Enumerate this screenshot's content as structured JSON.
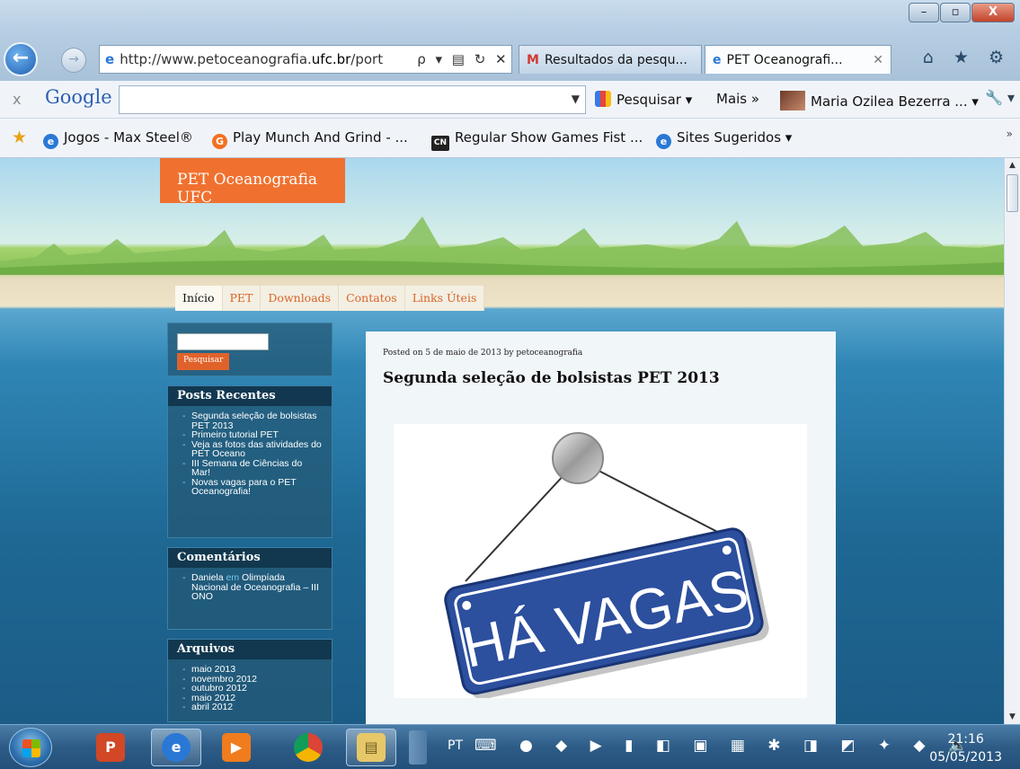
{
  "browser": {
    "window_controls": {
      "minimize": "–",
      "maximize": "▫",
      "close": "X"
    },
    "address_bar": {
      "url_prefix": "http://www.petoceanografia.",
      "url_host": "ufc.br",
      "url_suffix": "/port",
      "tools": "ρ ▾ ▤ ↻ ✕"
    },
    "tabs": [
      {
        "label": "Resultados da pesqu...",
        "icon": "gmail-icon"
      },
      {
        "label": "PET Oceanografi...",
        "icon": "ie-icon",
        "close": "✕"
      }
    ],
    "right_icons": "⌂ ★ ⚙"
  },
  "google_toolbar": {
    "close": "x",
    "logo": "Google",
    "search_value": "",
    "search_dropdown": "▼",
    "search_button": "Pesquisar ▾",
    "more": "Mais »",
    "user": "Maria Ozilea Bezerra ... ▾",
    "wrench": "🔧 ▾"
  },
  "favorites": [
    {
      "label": "Jogos - Max Steel®",
      "icon": "ie",
      "glyph": "e"
    },
    {
      "label": "Play Munch And Grind - ...",
      "icon": "g",
      "glyph": "G"
    },
    {
      "label": "Regular Show Games  Fist ...",
      "icon": "cn",
      "glyph": "CN"
    },
    {
      "label": "Sites Sugeridos ▾",
      "icon": "ie",
      "glyph": "e"
    }
  ],
  "favorites_chevron": "»",
  "site": {
    "title": "PET Oceanografia UFC",
    "nav": [
      "Início",
      "PET",
      "Downloads",
      "Contatos",
      "Links Úteis"
    ],
    "search": {
      "value": "",
      "button": "Pesquisar"
    },
    "posts_recentes": {
      "heading": "Posts Recentes",
      "items": [
        "Segunda seleção de bolsistas PET 2013",
        "Primeiro tutorial PET",
        "Veja as fotos das atividades do PET Oceano",
        "III Semana de Ciências do Mar!",
        "Novas vagas para o PET Oceanografia!"
      ]
    },
    "comentarios": {
      "heading": "Comentários",
      "author": "Daniela",
      "connector": " em ",
      "post": "Olimpíada Nacional de Oceanografia – III ONO"
    },
    "arquivos": {
      "heading": "Arquivos",
      "items": [
        "maio 2013",
        "novembro 2012",
        "outubro 2012",
        "maio 2012",
        "abril 2012"
      ]
    },
    "post": {
      "meta": "Posted on 5 de maio de 2013 by petoceanografia",
      "title": "Segunda seleção de bolsistas PET 2013",
      "image_text": "HÁ VAGAS"
    }
  },
  "taskbar": {
    "language": "PT",
    "time": "21:16",
    "date": "05/05/2013"
  }
}
